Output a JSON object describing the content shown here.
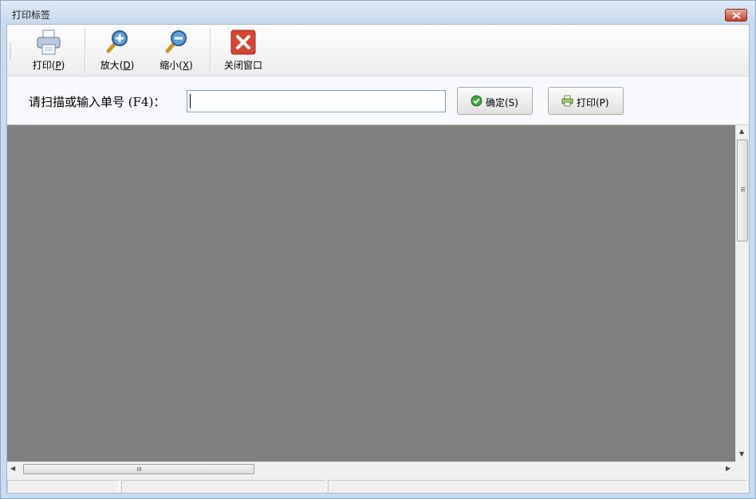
{
  "window": {
    "title": "打印标签"
  },
  "toolbar": {
    "print": {
      "label": "打印(",
      "key": "P",
      "tail": ")",
      "icon": "printer-icon"
    },
    "zoom_in": {
      "label": "放大(",
      "key": "D",
      "tail": ")",
      "icon": "zoom-in-icon"
    },
    "zoom_out": {
      "label": "缩小(",
      "key": "X",
      "tail": ")",
      "icon": "zoom-out-icon"
    },
    "close": {
      "label": "关闭窗口",
      "icon": "close-window-icon"
    }
  },
  "scan": {
    "label": "请扫描或输入单号 (F4)：",
    "value": "",
    "confirm_label": "确定(S)",
    "print_label": "打印(P)"
  },
  "colors": {
    "preview_background": "#808080",
    "close_red": "#d9432f",
    "confirm_green": "#3aa83a"
  }
}
